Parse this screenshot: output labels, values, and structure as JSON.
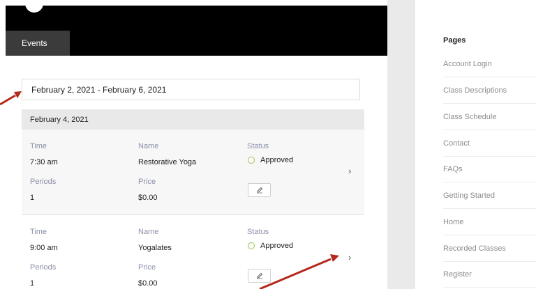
{
  "header": {
    "tab_label": "Events"
  },
  "date_range": {
    "value": "February 2, 2021 - February 6, 2021"
  },
  "day": {
    "label": "February 4, 2021"
  },
  "events": [
    {
      "time_label": "Time",
      "time": "7:30 am",
      "name_label": "Name",
      "name": "Restorative Yoga",
      "status_label": "Status",
      "status": "Approved",
      "periods_label": "Periods",
      "periods": "1",
      "price_label": "Price",
      "price": "$0.00"
    },
    {
      "time_label": "Time",
      "time": "9:00 am",
      "name_label": "Name",
      "name": "Yogalates",
      "status_label": "Status",
      "status": "Approved",
      "periods_label": "Periods",
      "periods": "1",
      "price_label": "Price",
      "price": "$0.00"
    }
  ],
  "sidebar": {
    "title": "Pages",
    "items": [
      "Account Login",
      "Class Descriptions",
      "Class Schedule",
      "Contact",
      "FAQs",
      "Getting Started",
      "Home",
      "Recorded Classes",
      "Register"
    ]
  },
  "colors": {
    "status_ok": "#9cc24a",
    "annotation_arrow": "#b5281c",
    "header_bg": "#000000"
  }
}
